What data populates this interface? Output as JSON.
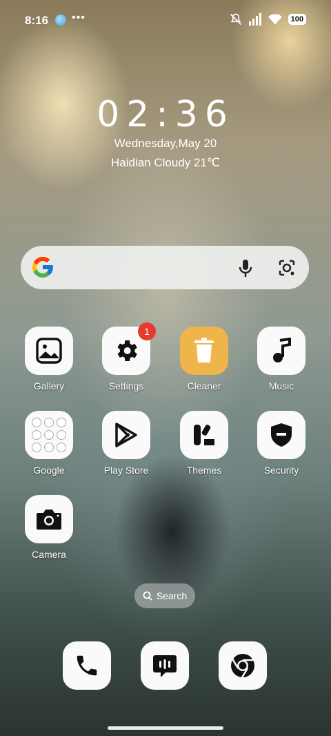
{
  "status_bar": {
    "time": "8:16",
    "more": "•••",
    "battery": "100",
    "icons": [
      "app-notification-icon",
      "mute-icon",
      "signal-icon",
      "wifi-icon",
      "battery-icon"
    ]
  },
  "lockscreen": {
    "clock": "02:36",
    "date": "Wednesday,May 20",
    "weather": "Haidian Cloudy 21℃"
  },
  "search_bar": {
    "icons": [
      "google-logo-icon",
      "microphone-icon",
      "lens-icon"
    ]
  },
  "apps": [
    {
      "label": "Gallery",
      "icon": "gallery-icon"
    },
    {
      "label": "Settings",
      "icon": "gear-icon",
      "badge": "1"
    },
    {
      "label": "Cleaner",
      "icon": "trash-icon"
    },
    {
      "label": "Music",
      "icon": "music-note-icon"
    },
    {
      "label": "Google",
      "icon": "google-folder-icon"
    },
    {
      "label": "Play Store",
      "icon": "play-store-icon"
    },
    {
      "label": "Themes",
      "icon": "themes-icon"
    },
    {
      "label": "Security",
      "icon": "shield-icon"
    },
    {
      "label": "Camera",
      "icon": "camera-icon"
    }
  ],
  "app_search": {
    "label": "Search"
  },
  "dock": [
    "phone-icon",
    "messages-icon",
    "chrome-icon"
  ],
  "colors": {
    "cleaner_bg": "#f0b54a",
    "badge": "#e53b30"
  }
}
